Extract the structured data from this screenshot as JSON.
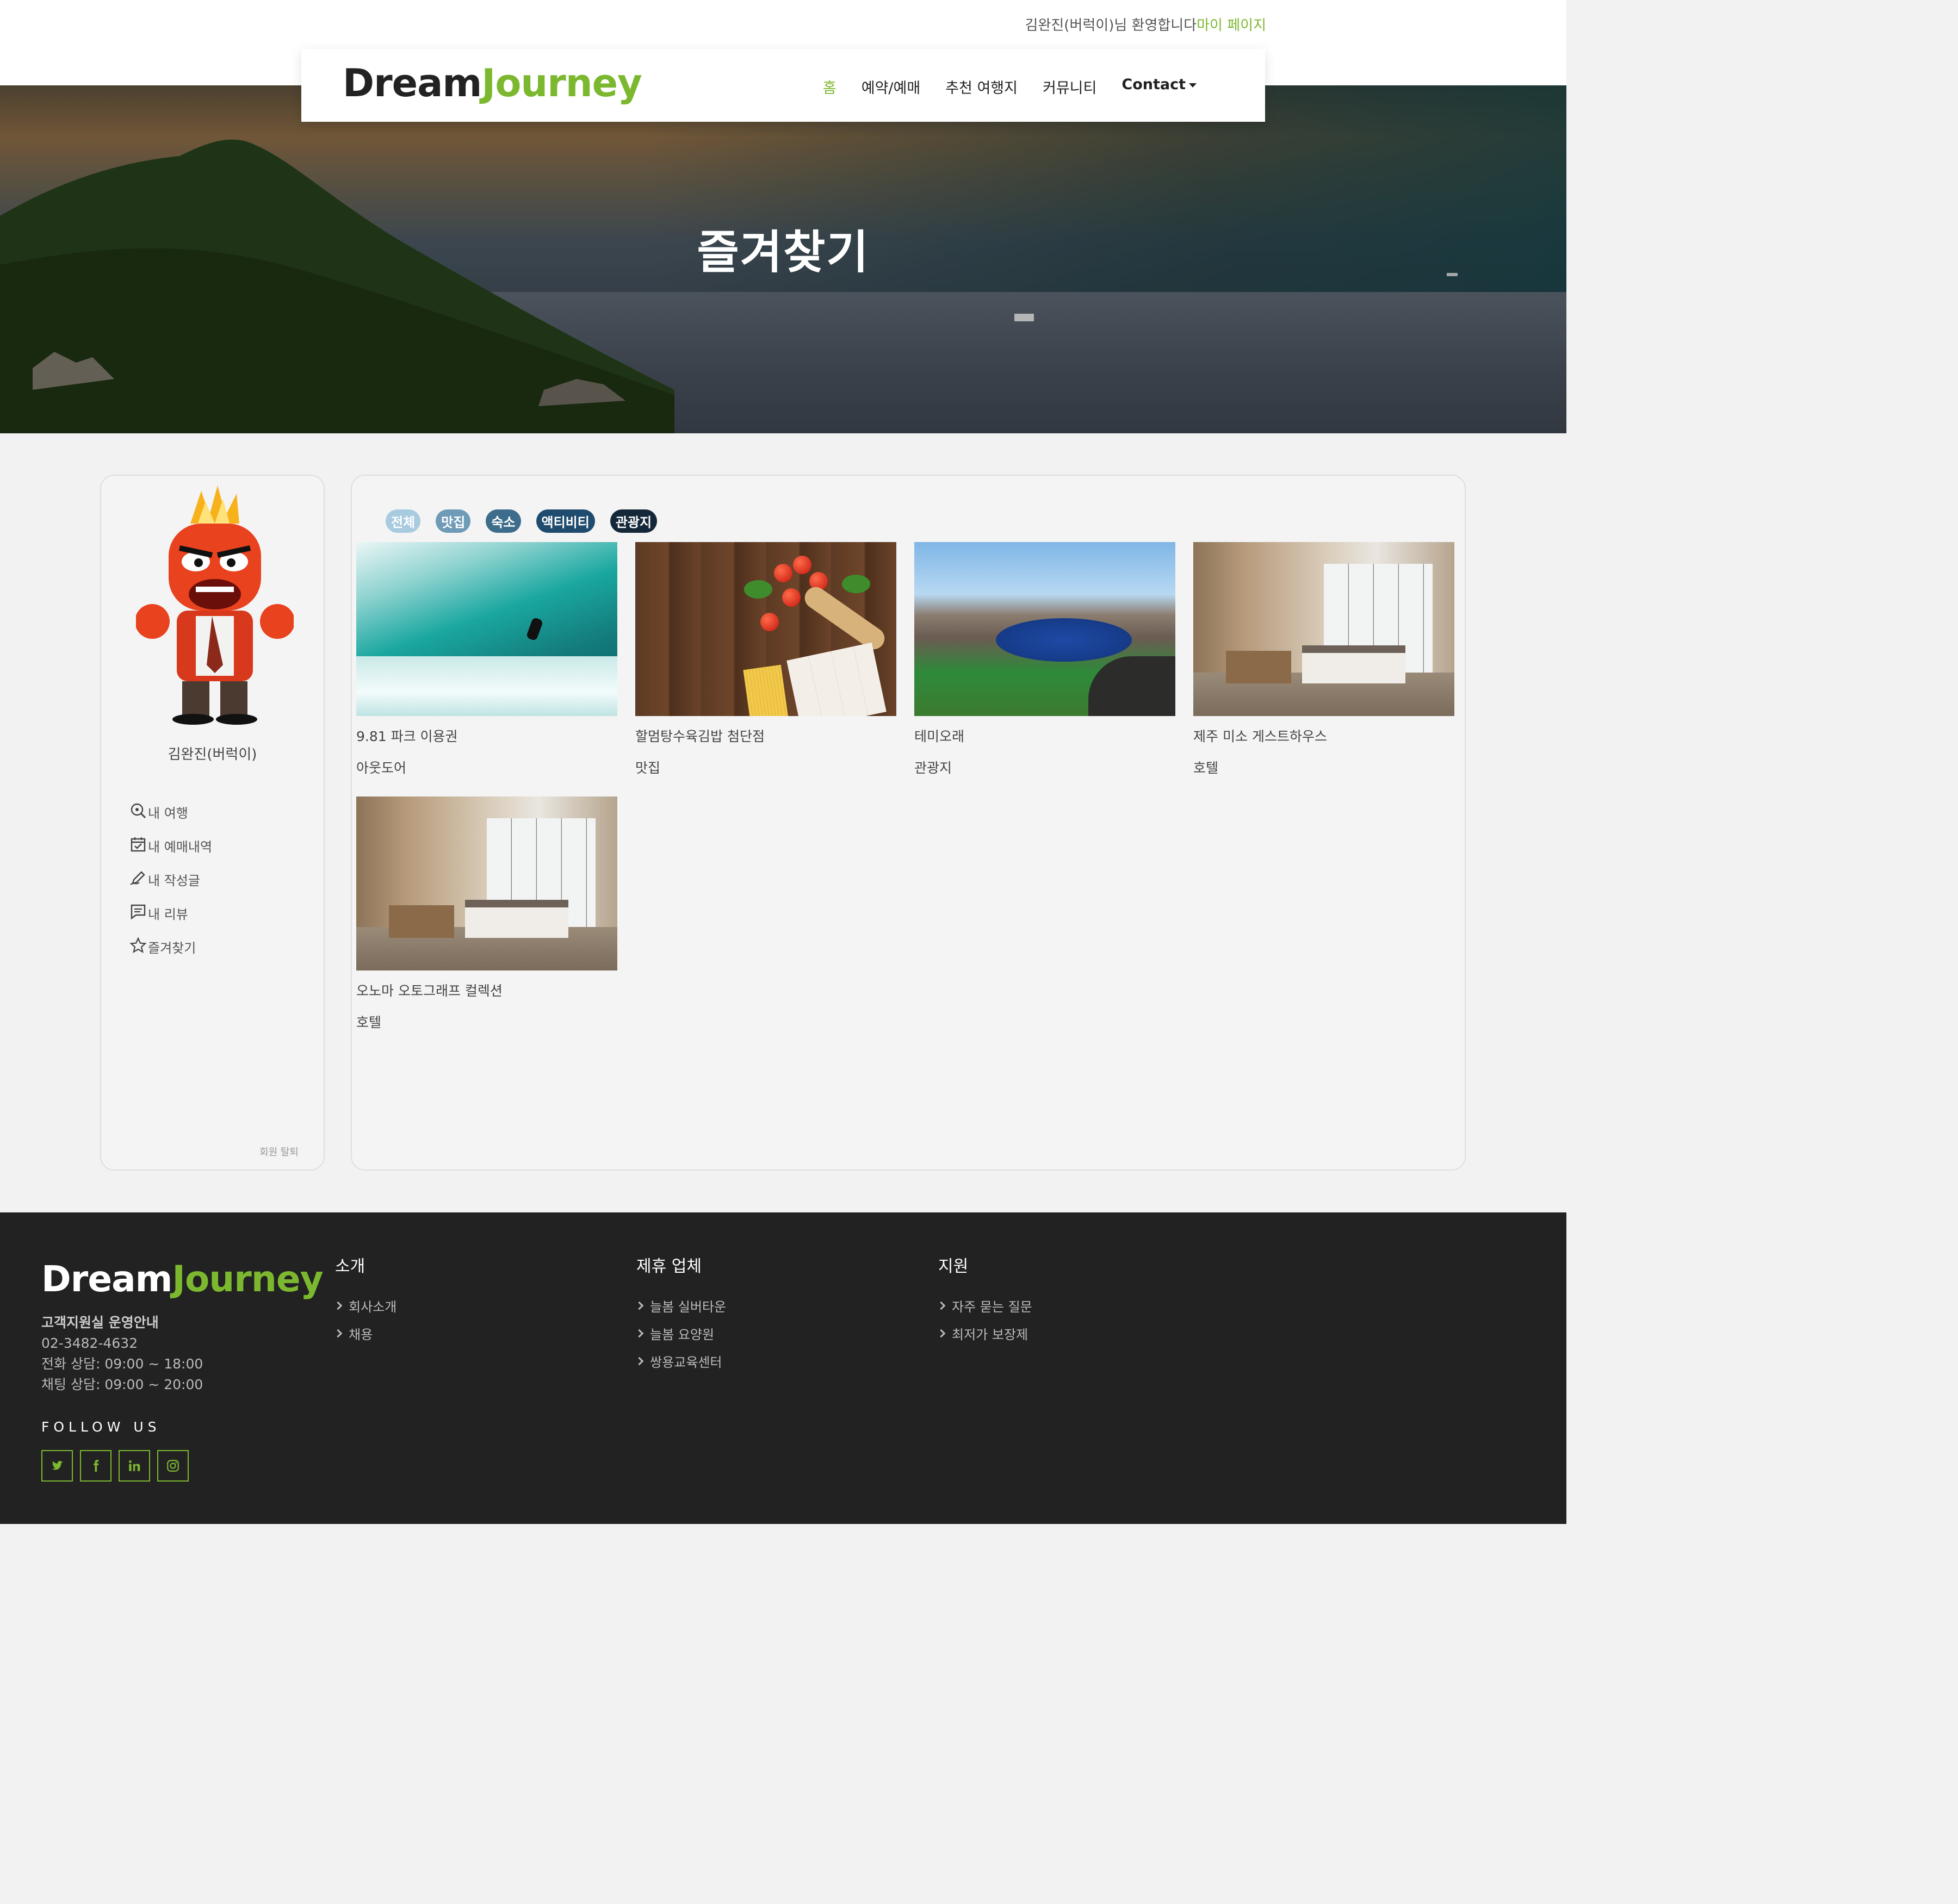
{
  "topbar": {
    "welcome": "김완진(버럭이)님 환영합니다",
    "mypage": "마이 페이지"
  },
  "brand": {
    "part1": "Dream",
    "part2": "Journey",
    "accent": "#7cb82f"
  },
  "nav": {
    "home": "홈",
    "booking": "예약/예매",
    "recommend": "추천 여행지",
    "community": "커뮤니티",
    "contact": "Contact"
  },
  "hero": {
    "title": "즐겨찾기"
  },
  "profile": {
    "name": "김완진(버럭이)",
    "menu": [
      {
        "label": "내 여행",
        "icon": "search-location-icon"
      },
      {
        "label": "내 예매내역",
        "icon": "calendar-check-icon"
      },
      {
        "label": "내 작성글",
        "icon": "pencil-icon"
      },
      {
        "label": "내 리뷰",
        "icon": "comment-icon"
      },
      {
        "label": "즐겨찾기",
        "icon": "star-icon"
      }
    ],
    "withdraw": "회원 탈퇴"
  },
  "filters": [
    {
      "label": "전체",
      "color": "#a9cbe0"
    },
    {
      "label": "맛집",
      "color": "#6f9bb7"
    },
    {
      "label": "숙소",
      "color": "#3e6c8b"
    },
    {
      "label": "액티비티",
      "color": "#1f4b6e"
    },
    {
      "label": "관광지",
      "color": "#14283a"
    }
  ],
  "favorites": [
    {
      "title": "9.81 파크 이용권",
      "category": "아웃도어"
    },
    {
      "title": "할멈탕수육김밥 첨단점",
      "category": "맛집"
    },
    {
      "title": "테미오래",
      "category": "관광지"
    },
    {
      "title": "제주 미소 게스트하우스",
      "category": "호텔"
    },
    {
      "title": "오노마 오토그래프 컬렉션",
      "category": "호텔"
    }
  ],
  "footer": {
    "support_title": "고객지원실 운영안내",
    "phone": "02-3482-4632",
    "phone_hours": "전화 상담: 09:00 ~ 18:00",
    "chat_hours": "채팅 상담: 09:00 ~ 20:00",
    "follow": "FOLLOW US",
    "col1": {
      "title": "소개",
      "links": [
        "회사소개",
        "채용"
      ]
    },
    "col2": {
      "title": "제휴 업체",
      "links": [
        "늘봄 실버타운",
        "늘봄 요양원",
        "쌍용교육센터"
      ]
    },
    "col3": {
      "title": "지원",
      "links": [
        "자주 묻는 질문",
        "최저가 보장제"
      ]
    }
  }
}
